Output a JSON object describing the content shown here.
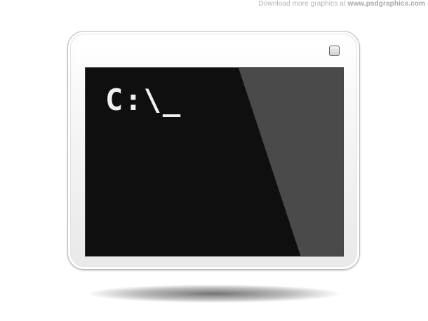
{
  "watermark": {
    "prefix": "Download more graphics at ",
    "site": "www.psdgraphics.com"
  },
  "window": {
    "maximize_icon": "maximize-icon"
  },
  "console": {
    "prompt": "C:\\_"
  },
  "colors": {
    "screen_background": "#0f0f0f",
    "screen_glare": "#4a4a4a",
    "text": "#f0f0f0",
    "frame": "#f4f4f4"
  }
}
